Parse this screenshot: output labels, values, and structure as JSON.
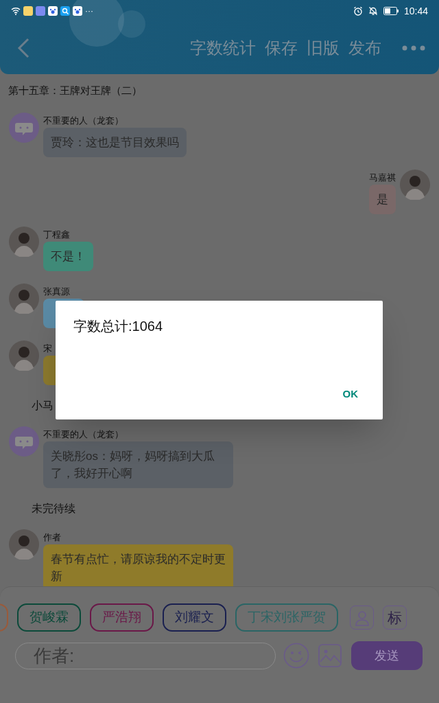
{
  "status_bar": {
    "time": "10:44",
    "more": "···"
  },
  "toolbar": {
    "actions": [
      "字数统计",
      "保存",
      "旧版",
      "发布"
    ]
  },
  "chapter_title": "第十五章：王牌对王牌（二）",
  "messages": [
    {
      "kind": "incoming",
      "avatar": {
        "kind": "bot"
      },
      "name": "不重要的人（龙套）",
      "text": "贾玲：这也是节目效果吗",
      "color": "#5b6066"
    },
    {
      "kind": "outgoing",
      "avatar": {
        "kind": "photo"
      },
      "name": "马嘉祺",
      "text": "是",
      "color": "#7a6868"
    },
    {
      "kind": "incoming",
      "avatar": {
        "kind": "photo"
      },
      "name": "丁程鑫",
      "text": "不是！",
      "color": "#3f8a78"
    },
    {
      "kind": "incoming",
      "avatar": {
        "kind": "photo"
      },
      "name": "张真源",
      "color": "#5a8aa5"
    },
    {
      "kind": "incoming",
      "avatar": {
        "kind": "photo"
      },
      "name": "宋",
      "color": "#8c7a2e"
    },
    {
      "kind": "narration",
      "text": "小马"
    },
    {
      "kind": "incoming",
      "avatar": {
        "kind": "bot"
      },
      "name": "不重要的人（龙套）",
      "text": "关晓彤os：妈呀，妈呀搞到大瓜了，我好开心啊",
      "color": "#5b6066"
    },
    {
      "kind": "narration",
      "text": "未完待续"
    },
    {
      "kind": "incoming",
      "avatar": {
        "kind": "photo"
      },
      "name": "作者",
      "text": "春节有点忙，请原谅我的不定时更新",
      "color": "#8f7b2a"
    }
  ],
  "role_chips": [
    {
      "color": "#9a5a3a"
    },
    {
      "label": "贺峻霖",
      "color": "#0c4a3a"
    },
    {
      "label": "严浩翔",
      "color": "#6a1848"
    },
    {
      "label": "刘耀文",
      "color": "#1a2050"
    },
    {
      "label": "丁宋刘张严贺",
      "color": "#2a6565"
    }
  ],
  "tag_button": "标",
  "input": {
    "placeholder": "作者:"
  },
  "send_button": "发送",
  "dialog": {
    "message": "字数总计:1064",
    "button": "OK"
  }
}
